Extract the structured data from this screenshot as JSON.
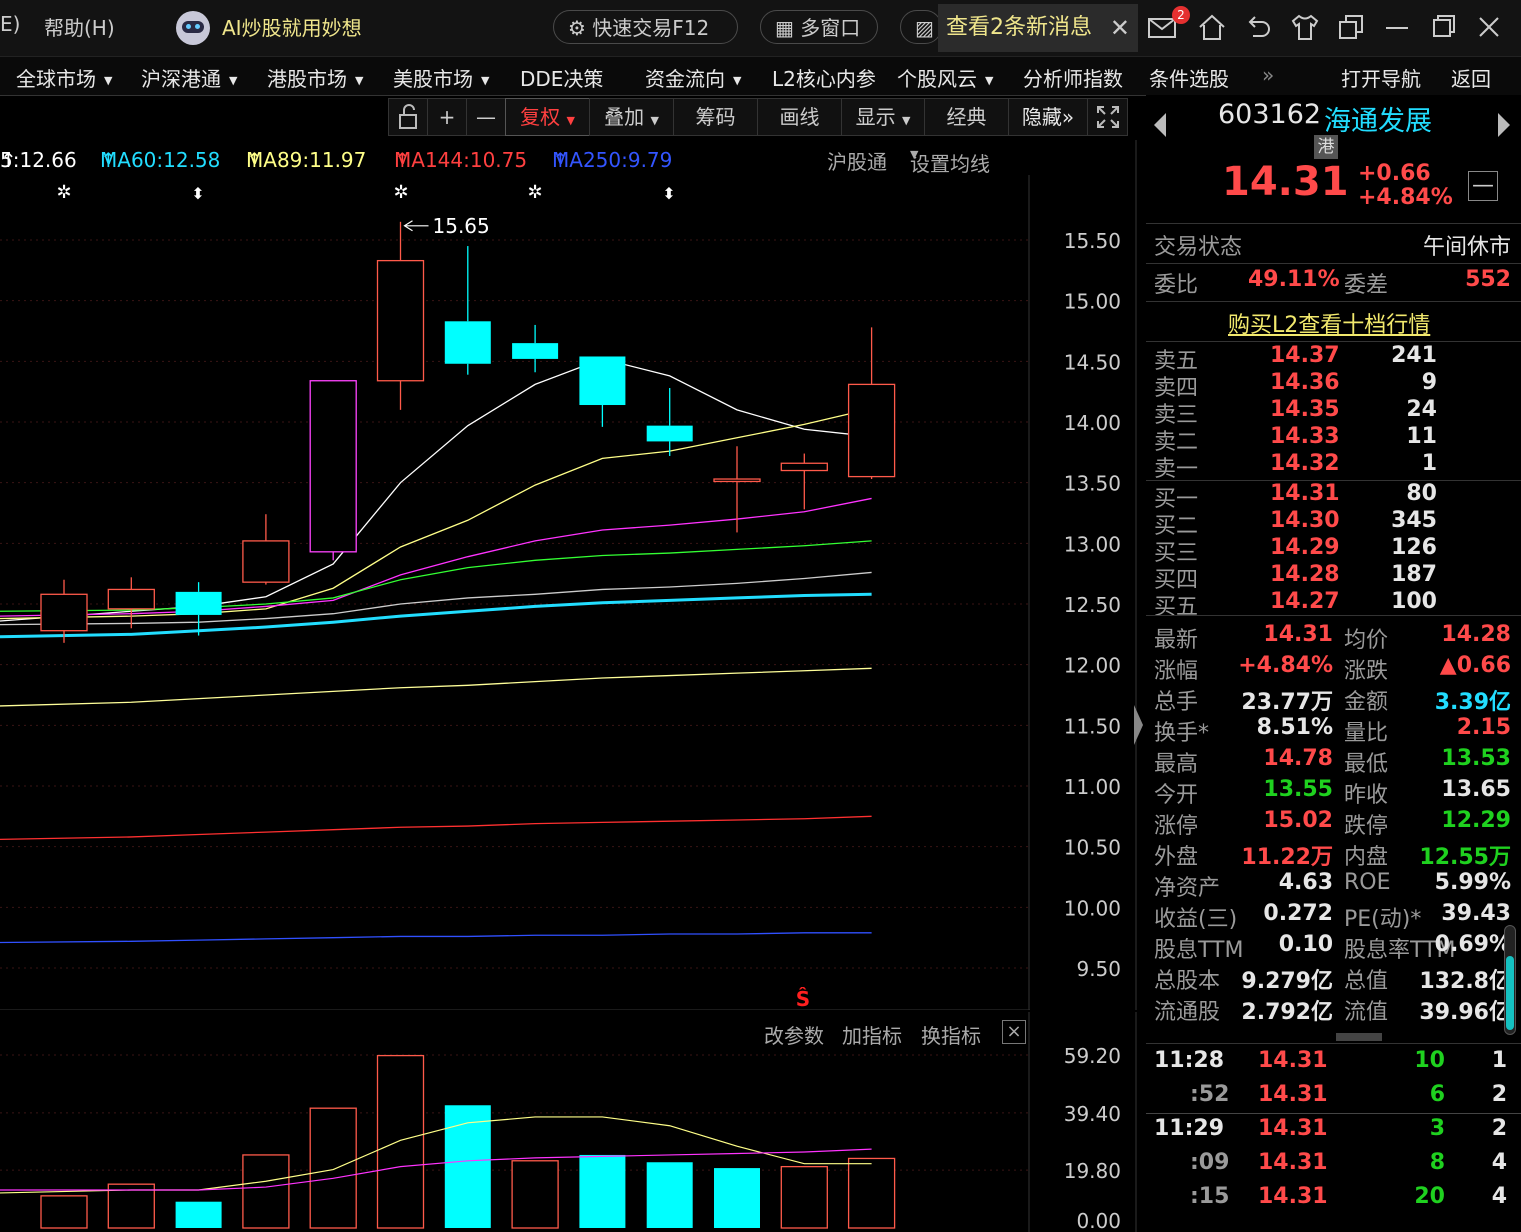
{
  "titlebar": {
    "partial_menu": "E)",
    "help_menu": "帮助(H)",
    "ai_title": "AI炒股就用妙想",
    "quick_trade": "快速交易F12",
    "multi_window": "多窗口",
    "message_tab": "查看2条新消息",
    "mail_badge": "2"
  },
  "navbar": {
    "items": [
      {
        "label": "全球市场",
        "dd": "▼"
      },
      {
        "label": "沪深港通",
        "dd": "▼"
      },
      {
        "label": "港股市场",
        "dd": "▼"
      },
      {
        "label": "美股市场",
        "dd": "▼"
      },
      {
        "label": "DDE决策",
        "dd": ""
      },
      {
        "label": "资金流向",
        "dd": "▼"
      },
      {
        "label": "L2核心内参",
        "dd": ""
      },
      {
        "label": "个股风云",
        "dd": "▼"
      },
      {
        "label": "分析师指数",
        "dd": ""
      },
      {
        "label": "条件选股",
        "dd": ""
      }
    ],
    "more": "»",
    "open_nav": "打开导航",
    "back": "返回"
  },
  "toolbar": {
    "plus": "+",
    "minus": "—",
    "fuquan": "复权",
    "overlay": "叠加",
    "chips": "筹码",
    "draw": "画线",
    "display": "显示",
    "classic": "经典",
    "hide": "隐藏",
    "hide_arrow": "»"
  },
  "ma_legend": {
    "ma_partial": "5:12.66",
    "ma60": "MA60:12.58",
    "ma89": "MA89:11.97",
    "ma144": "MA144:10.75",
    "ma250": "MA250:9.79",
    "arrow": "↑",
    "hgt": "沪股通",
    "set_ma": "设置均线"
  },
  "chart_data": [
    {
      "type": "candlestick",
      "price_axis": [
        "15.50",
        "15.00",
        "14.50",
        "14.00",
        "13.50",
        "13.00",
        "12.50",
        "12.00",
        "11.50",
        "11.00",
        "10.50",
        "10.00",
        "9.50"
      ],
      "ylim": [
        9.2,
        16.1
      ],
      "high_label": "15.65",
      "candles": [
        {
          "open": 12.28,
          "close": 12.58,
          "high": 12.7,
          "low": 12.18,
          "dir": "up"
        },
        {
          "open": 12.46,
          "close": 12.62,
          "high": 12.72,
          "low": 12.3,
          "dir": "up"
        },
        {
          "open": 12.6,
          "close": 12.41,
          "high": 12.68,
          "low": 12.24,
          "dir": "down"
        },
        {
          "open": 12.68,
          "close": 13.02,
          "high": 13.24,
          "low": 12.66,
          "dir": "up"
        },
        {
          "open": 12.93,
          "close": 14.34,
          "high": 14.34,
          "low": 12.86,
          "dir": "up"
        },
        {
          "open": 14.34,
          "close": 15.33,
          "high": 15.65,
          "low": 14.1,
          "dir": "up"
        },
        {
          "open": 14.83,
          "close": 14.48,
          "high": 15.45,
          "low": 14.39,
          "dir": "down"
        },
        {
          "open": 14.65,
          "close": 14.52,
          "high": 14.8,
          "low": 14.41,
          "dir": "down"
        },
        {
          "open": 14.54,
          "close": 14.14,
          "high": 14.54,
          "low": 13.96,
          "dir": "down"
        },
        {
          "open": 13.97,
          "close": 13.84,
          "high": 14.28,
          "low": 13.72,
          "dir": "down"
        },
        {
          "open": 13.53,
          "close": 13.51,
          "high": 13.8,
          "low": 13.09,
          "dir": "flat"
        },
        {
          "open": 13.6,
          "close": 13.66,
          "high": 13.74,
          "low": 13.28,
          "dir": "up"
        },
        {
          "open": 13.55,
          "close": 14.31,
          "high": 14.78,
          "low": 13.53,
          "dir": "up"
        }
      ],
      "ma_lines": [
        {
          "color": "#ffffff",
          "values": [
            12.36,
            12.44,
            12.48,
            12.56,
            12.83,
            13.5,
            13.97,
            14.31,
            14.52,
            14.38,
            14.1,
            13.94,
            13.88
          ]
        },
        {
          "color": "#ffff88",
          "values": [
            12.38,
            12.4,
            12.42,
            12.46,
            12.63,
            12.97,
            13.19,
            13.48,
            13.7,
            13.76,
            13.87,
            13.98,
            14.11
          ]
        },
        {
          "color": "#ff33ff",
          "values": [
            12.4,
            12.42,
            12.44,
            12.48,
            12.53,
            12.74,
            12.89,
            13.02,
            13.11,
            13.15,
            13.2,
            13.26,
            13.37
          ]
        },
        {
          "color": "#33ff33",
          "values": [
            12.44,
            12.45,
            12.47,
            12.5,
            12.55,
            12.7,
            12.8,
            12.86,
            12.9,
            12.92,
            12.95,
            12.98,
            13.02
          ]
        },
        {
          "color": "#cccccc",
          "values": [
            12.33,
            12.34,
            12.35,
            12.38,
            12.42,
            12.5,
            12.55,
            12.58,
            12.62,
            12.64,
            12.67,
            12.71,
            12.76
          ]
        },
        {
          "color": "#22ddff",
          "values": [
            12.23,
            12.25,
            12.28,
            12.31,
            12.35,
            12.4,
            12.44,
            12.48,
            12.51,
            12.53,
            12.55,
            12.57,
            12.58
          ]
        },
        {
          "color": "#ffff99",
          "values": [
            11.66,
            11.69,
            11.72,
            11.75,
            11.78,
            11.81,
            11.83,
            11.86,
            11.89,
            11.91,
            11.93,
            11.95,
            11.97
          ]
        },
        {
          "color": "#ff3030",
          "values": [
            10.56,
            10.58,
            10.6,
            10.62,
            10.64,
            10.66,
            10.67,
            10.69,
            10.7,
            10.71,
            10.72,
            10.73,
            10.75
          ]
        },
        {
          "color": "#3050ff",
          "values": [
            9.71,
            9.72,
            9.73,
            9.74,
            9.75,
            9.76,
            9.76,
            9.77,
            9.77,
            9.78,
            9.78,
            9.79,
            9.79
          ]
        }
      ]
    },
    {
      "type": "bar",
      "volume_axis": [
        "59.20",
        "39.40",
        "19.80",
        "0.00"
      ],
      "ylim": [
        0,
        59.2
      ],
      "volumes": [
        {
          "v": 11,
          "dir": "up"
        },
        {
          "v": 15,
          "dir": "up"
        },
        {
          "v": 9,
          "dir": "down"
        },
        {
          "v": 25,
          "dir": "up"
        },
        {
          "v": 41,
          "dir": "up"
        },
        {
          "v": 59,
          "dir": "up"
        },
        {
          "v": 42,
          "dir": "down"
        },
        {
          "v": 23,
          "dir": "up"
        },
        {
          "v": 25,
          "dir": "down"
        },
        {
          "v": 22.5,
          "dir": "down"
        },
        {
          "v": 20.5,
          "dir": "down"
        },
        {
          "v": 21,
          "dir": "up"
        },
        {
          "v": 23.8,
          "dir": "up"
        }
      ],
      "vol_ma": [
        {
          "color": "#ffff88",
          "values": [
            12,
            13,
            13,
            16,
            20,
            30,
            36,
            38,
            38,
            35,
            28,
            22,
            22
          ]
        },
        {
          "color": "#ff33ff",
          "values": [
            13,
            13,
            13,
            14,
            17,
            21,
            23,
            24,
            24.5,
            25,
            25.5,
            26,
            27
          ]
        }
      ]
    }
  ],
  "volume_bar": {
    "change_params": "改参数",
    "add_indicator": "加指标",
    "switch_indicator": "换指标",
    "close": "×"
  },
  "right_panel": {
    "code": "603162",
    "name": "海通发展",
    "hk_tag": "港",
    "price": "14.31",
    "change": "+0.66",
    "change_pct": "+4.84%",
    "trade_status_label": "交易状态",
    "trade_status": "午间休市",
    "weibi_label": "委比",
    "weibi": "49.11%",
    "weicha_label": "委差",
    "weicha": "552",
    "l2_link": "购买L2查看十档行情",
    "asks": [
      {
        "label": "卖五",
        "price": "14.37",
        "vol": "241"
      },
      {
        "label": "卖四",
        "price": "14.36",
        "vol": "9"
      },
      {
        "label": "卖三",
        "price": "14.35",
        "vol": "24"
      },
      {
        "label": "卖二",
        "price": "14.33",
        "vol": "11"
      },
      {
        "label": "卖一",
        "price": "14.32",
        "vol": "1"
      }
    ],
    "bids": [
      {
        "label": "买一",
        "price": "14.31",
        "vol": "80"
      },
      {
        "label": "买二",
        "price": "14.30",
        "vol": "345"
      },
      {
        "label": "买三",
        "price": "14.29",
        "vol": "126"
      },
      {
        "label": "买四",
        "price": "14.28",
        "vol": "187"
      },
      {
        "label": "买五",
        "price": "14.27",
        "vol": "100"
      }
    ],
    "stats": [
      {
        "l1": "最新",
        "v1": "14.31",
        "c1": "red",
        "l2": "均价",
        "v2": "14.28",
        "c2": "red"
      },
      {
        "l1": "涨幅",
        "v1": "+4.84%",
        "c1": "red",
        "l2": "涨跌",
        "v2": "▲0.66",
        "c2": "red"
      },
      {
        "l1": "总手",
        "v1": "23.77万",
        "c1": "white",
        "l2": "金额",
        "v2": "3.39亿",
        "c2": "cyan"
      },
      {
        "l1": "换手*",
        "v1": "8.51%",
        "c1": "white",
        "l2": "量比",
        "v2": "2.15",
        "c2": "red"
      },
      {
        "l1": "最高",
        "v1": "14.78",
        "c1": "red",
        "l2": "最低",
        "v2": "13.53",
        "c2": "green"
      },
      {
        "l1": "今开",
        "v1": "13.55",
        "c1": "green",
        "l2": "昨收",
        "v2": "13.65",
        "c2": "white"
      },
      {
        "l1": "涨停",
        "v1": "15.02",
        "c1": "red",
        "l2": "跌停",
        "v2": "12.29",
        "c2": "green"
      },
      {
        "l1": "外盘",
        "v1": "11.22万",
        "c1": "red",
        "l2": "内盘",
        "v2": "12.55万",
        "c2": "green"
      },
      {
        "l1": "净资产",
        "v1": "4.63",
        "c1": "white",
        "l2": "ROE",
        "v2": "5.99%",
        "c2": "white"
      },
      {
        "l1": "收益(三)",
        "v1": "0.272",
        "c1": "white",
        "l2": "PE(动)*",
        "v2": "39.43",
        "c2": "white"
      },
      {
        "l1": "股息TTM",
        "v1": "0.10",
        "c1": "white",
        "l2": "股息率TTM",
        "v2": "0.69%",
        "c2": "white"
      },
      {
        "l1": "总股本",
        "v1": "9.279亿",
        "c1": "white",
        "l2": "总值",
        "v2": "132.8亿",
        "c2": "white"
      },
      {
        "l1": "流通股",
        "v1": "2.792亿",
        "c1": "white",
        "l2": "流值",
        "v2": "39.96亿",
        "c2": "white"
      }
    ],
    "ticks": [
      {
        "time": "11:28",
        "price": "14.31",
        "vol": "10",
        "n": "1"
      },
      {
        "time": ":52",
        "price": "14.31",
        "vol": "6",
        "n": "2"
      },
      {
        "time": "11:29",
        "price": "14.31",
        "vol": "3",
        "n": "2"
      },
      {
        "time": ":09",
        "price": "14.31",
        "vol": "8",
        "n": "4"
      },
      {
        "time": ":15",
        "price": "14.31",
        "vol": "20",
        "n": "4"
      }
    ]
  }
}
